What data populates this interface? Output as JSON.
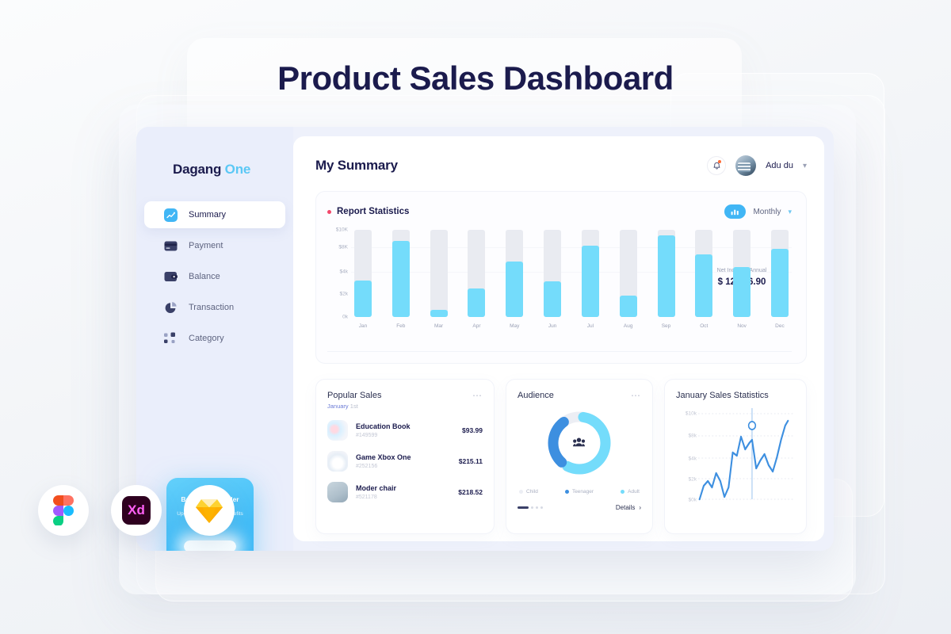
{
  "page": {
    "title": "Product Sales Dashboard"
  },
  "sidebar": {
    "brand": {
      "primary": "Dagang",
      "accent": "One"
    },
    "items": [
      {
        "label": "Summary",
        "icon": "chart-icon",
        "active": true
      },
      {
        "label": "Payment",
        "icon": "credit-card-icon",
        "active": false
      },
      {
        "label": "Balance",
        "icon": "wallet-icon",
        "active": false
      },
      {
        "label": "Transaction",
        "icon": "pie-chart-icon",
        "active": false
      },
      {
        "label": "Category",
        "icon": "grid-icon",
        "active": false
      }
    ],
    "promo": {
      "title": "Become top seller",
      "subtitle": "Upgrade now for get benefits more",
      "button_label": ""
    }
  },
  "topbar": {
    "title": "My Summary",
    "notification_icon": "bell-icon",
    "user_name": "Adu du",
    "caret_icon": "chevron-down-icon"
  },
  "report": {
    "title": "Report Statistics",
    "period": "Monthly",
    "toggle_icon": "bar-chart-icon",
    "caret_icon": "chevron-down-icon",
    "net_income_label": "Net Incomes Annual",
    "net_income_value": "$ 12.416.90",
    "trend_icon": "trend-arrows-icon"
  },
  "popular_sales": {
    "title": "Popular Sales",
    "date_month": "January",
    "date_day": "1st",
    "menu_icon": "more-dots-icon",
    "items": [
      {
        "name": "Education Book",
        "id": "#149599",
        "price": "$93.99",
        "thumb": "education-book-thumb"
      },
      {
        "name": "Game Xbox One",
        "id": "#252156",
        "price": "$215.11",
        "thumb": "game-xbox-thumb"
      },
      {
        "name": "Moder chair",
        "id": "#521178",
        "price": "$218.52",
        "thumb": "moder-chair-thumb"
      }
    ]
  },
  "audience": {
    "title": "Audience",
    "menu_icon": "more-dots-icon",
    "center_icon": "people-icon",
    "details_label": "Details",
    "details_arrow": "chevron-right-icon",
    "legend": [
      {
        "label": "Child",
        "color": "#eceef4"
      },
      {
        "label": "Teenager",
        "color": "#3d8fe0"
      },
      {
        "label": "Adult",
        "color": "#74dcfb"
      }
    ]
  },
  "january": {
    "title": "January Sales Statistics"
  },
  "tool_icons": [
    {
      "name": "figma-icon"
    },
    {
      "name": "adobe-xd-icon"
    },
    {
      "name": "sketch-icon"
    }
  ],
  "colors": {
    "accent_cyan": "#74dcfb",
    "accent_blue": "#41b6f5",
    "navy": "#1b1b4d",
    "green": "#2ecc8f",
    "red": "#f3476b"
  },
  "chart_data": [
    {
      "type": "bar",
      "title": "Report Statistics",
      "categories": [
        "Jan",
        "Feb",
        "Mar",
        "Apr",
        "May",
        "Jun",
        "Jul",
        "Aug",
        "Sep",
        "Oct",
        "Nov",
        "Dec"
      ],
      "values": [
        4200,
        8700,
        800,
        3300,
        6400,
        4100,
        8200,
        2500,
        9400,
        7200,
        5700,
        7800
      ],
      "track_max": 10000,
      "ylabel": "",
      "xlabel": "",
      "ylim": [
        0,
        10000
      ],
      "ytick_labels": [
        "$10K",
        "$8K",
        "$4k",
        "$2k",
        "0k"
      ],
      "ytick_values": [
        10000,
        8000,
        4000,
        2000,
        0
      ],
      "grid": true,
      "legend": "none",
      "series_color": "#74dcfb",
      "track_color": "#e9ebf1"
    },
    {
      "type": "pie",
      "title": "Audience",
      "labels": [
        "Child",
        "Teenager",
        "Adult"
      ],
      "values": [
        17,
        28,
        55
      ],
      "colors": [
        "#eceef4",
        "#3d8fe0",
        "#74dcfb"
      ],
      "legend": "bottom"
    },
    {
      "type": "line",
      "title": "January Sales Statistics",
      "x": [
        0,
        1,
        2,
        3,
        4,
        5,
        6,
        7,
        8,
        9,
        10,
        11,
        12,
        13,
        14,
        15,
        16,
        17,
        18,
        19,
        20
      ],
      "values": [
        0,
        1300,
        700,
        900,
        2100,
        1400,
        200,
        1000,
        4700,
        4300,
        7200,
        5600,
        3400,
        4800,
        3900,
        3200,
        4800,
        8000
      ],
      "ytick_labels": [
        "$10k",
        "$8k",
        "$4k",
        "$2k",
        "$0k"
      ],
      "ytick_values": [
        10000,
        8000,
        4000,
        2000,
        0
      ],
      "ylim": [
        0,
        10000
      ],
      "grid": true,
      "marker_value": 9200,
      "line_color": "#3d8fe0",
      "legend": "none"
    }
  ]
}
